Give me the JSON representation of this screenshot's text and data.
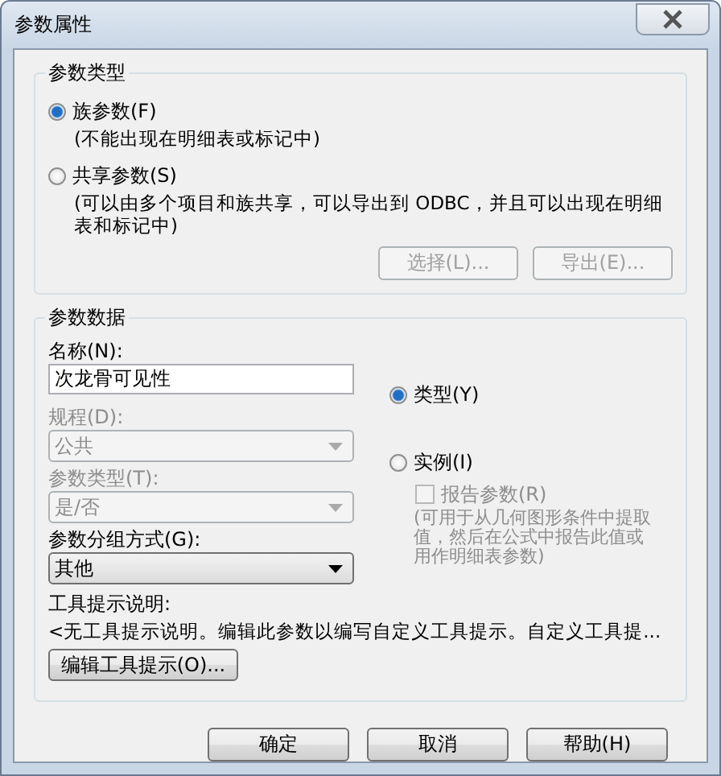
{
  "window": {
    "title": "参数属性"
  },
  "parameter_type": {
    "legend": "参数类型",
    "options": [
      {
        "label": "族参数(F)",
        "note": "(不能出现在明细表或标记中)",
        "selected": true
      },
      {
        "label": "共享参数(S)",
        "note": "(可以由多个项目和族共享，可以导出到 ODBC，并且可以出现在明细表和标记中)",
        "selected": false
      }
    ],
    "buttons": [
      {
        "label": "选择(L)...",
        "disabled": true
      },
      {
        "label": "导出(E)...",
        "disabled": true
      }
    ]
  },
  "parameter_data": {
    "legend": "参数数据",
    "name": {
      "label": "名称(N):",
      "value": "次龙骨可见性"
    },
    "selects": [
      {
        "label": "规程(D):",
        "value": "公共",
        "disabled": true
      },
      {
        "label": "参数类型(T):",
        "value": "是/否",
        "disabled": true
      },
      {
        "label": "参数分组方式(G):",
        "value": "其他",
        "disabled": false
      }
    ],
    "scope_options": [
      {
        "label": "类型(Y)",
        "selected": true
      },
      {
        "label": "实例(I)",
        "selected": false
      }
    ],
    "report_parameter": {
      "label": "报告参数(R)",
      "checked": false,
      "disabled": true,
      "note": "(可用于从几何图形条件中提取值，然后在公式中报告此值或用作明细表参数)"
    },
    "tooltip": {
      "label": "工具提示说明:",
      "text": "<无工具提示说明。编辑此参数以编写自定义工具提示。自定义工具提...",
      "button": "编辑工具提示(O)..."
    }
  },
  "buttons": [
    "确定",
    "取消",
    "帮助(H)"
  ]
}
